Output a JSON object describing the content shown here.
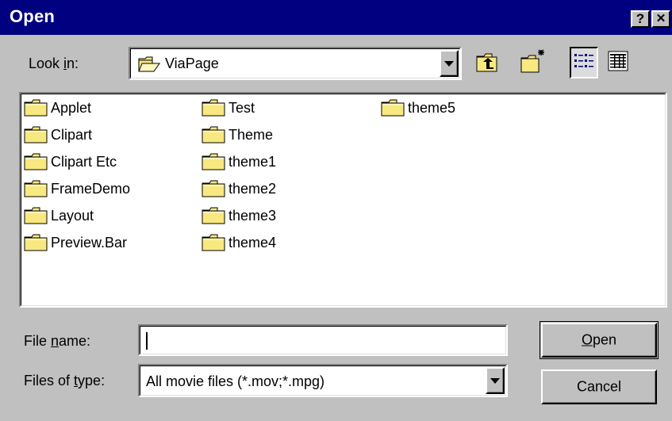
{
  "window": {
    "title": "Open",
    "help_label": "?",
    "close_label": "✕"
  },
  "look_in": {
    "label_pre": "Look ",
    "label_accel": "i",
    "label_post": "n:",
    "value": "ViaPage",
    "icon": "open-folder-icon"
  },
  "toolbar": {
    "up_icon": "up-one-level-icon",
    "new_folder_icon": "create-new-folder-icon",
    "list_icon": "list-view-icon",
    "details_icon": "details-view-icon",
    "list_pressed": true
  },
  "files": {
    "columns": [
      [
        "Applet",
        "Clipart",
        "Clipart Etc",
        "FrameDemo",
        "Layout",
        "Preview.Bar"
      ],
      [
        "Test",
        "Theme",
        "theme1",
        "theme2",
        "theme3",
        "theme4"
      ],
      [
        "theme5"
      ]
    ],
    "item_icon": "folder-icon"
  },
  "file_name": {
    "label_pre": "File ",
    "label_accel": "n",
    "label_post": "ame:",
    "value": ""
  },
  "file_type": {
    "label_pre": "Files of ",
    "label_accel": "t",
    "label_post": "ype:",
    "value": "All movie files (*.mov;*.mpg)"
  },
  "buttons": {
    "open_accel": "O",
    "open_rest": "pen",
    "cancel": "Cancel"
  },
  "colors": {
    "titlebar": "#000080",
    "face": "#c0c0c0",
    "folder": "#f8e880"
  }
}
